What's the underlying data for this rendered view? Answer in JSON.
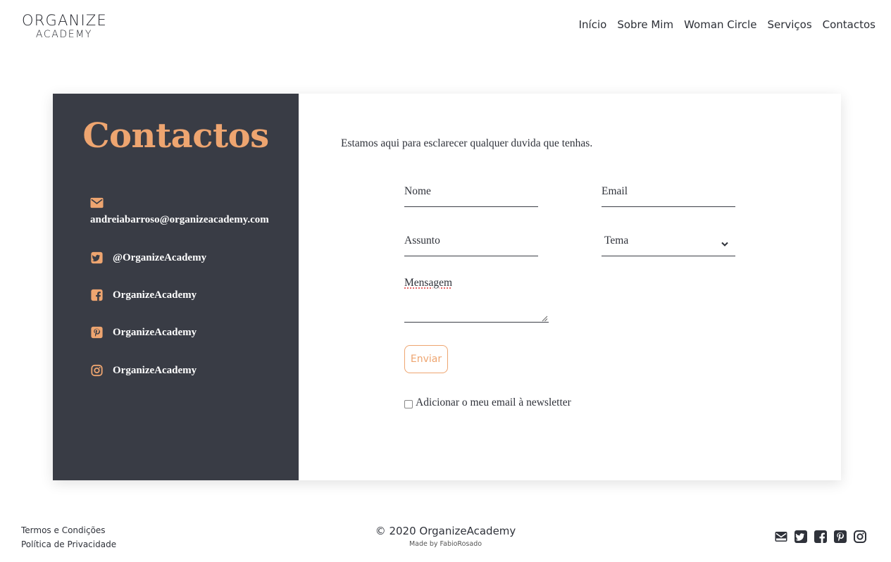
{
  "logo": {
    "top": "ORGANIZE",
    "bottom": "ACADEMY"
  },
  "nav": {
    "items": [
      {
        "label": "Início"
      },
      {
        "label": "Sobre Mim"
      },
      {
        "label": "Woman Circle"
      },
      {
        "label": "Serviços"
      },
      {
        "label": "Contactos"
      }
    ]
  },
  "contact_panel": {
    "title": "Contactos",
    "email": "andreiabarroso@organizeacademy.com",
    "twitter": "@OrganizeAcademy",
    "facebook": "OrganizeAcademy",
    "pinterest": "OrganizeAcademy",
    "instagram": "OrganizeAcademy",
    "accent_color": "#eea570",
    "panel_color": "#393c45"
  },
  "form": {
    "intro": "Estamos aqui para esclarecer qualquer duvida que tenhas.",
    "name_placeholder": "Nome",
    "email_placeholder": "Email",
    "subject_placeholder": "Assunto",
    "topic_selected": "Tema",
    "message_placeholder": "Mensagem",
    "send_label": "Enviar",
    "newsletter_label": "Adicionar o meu email à newsletter",
    "newsletter_checked": false
  },
  "footer": {
    "terms": "Termos e Condições",
    "privacy": "Política de Privacidade",
    "copyright": "© 2020 OrganizeAcademy",
    "made_by": "Made by FabioRosado",
    "social_icons": [
      "envelope-icon",
      "twitter-icon",
      "facebook-icon",
      "pinterest-icon",
      "instagram-icon"
    ]
  }
}
